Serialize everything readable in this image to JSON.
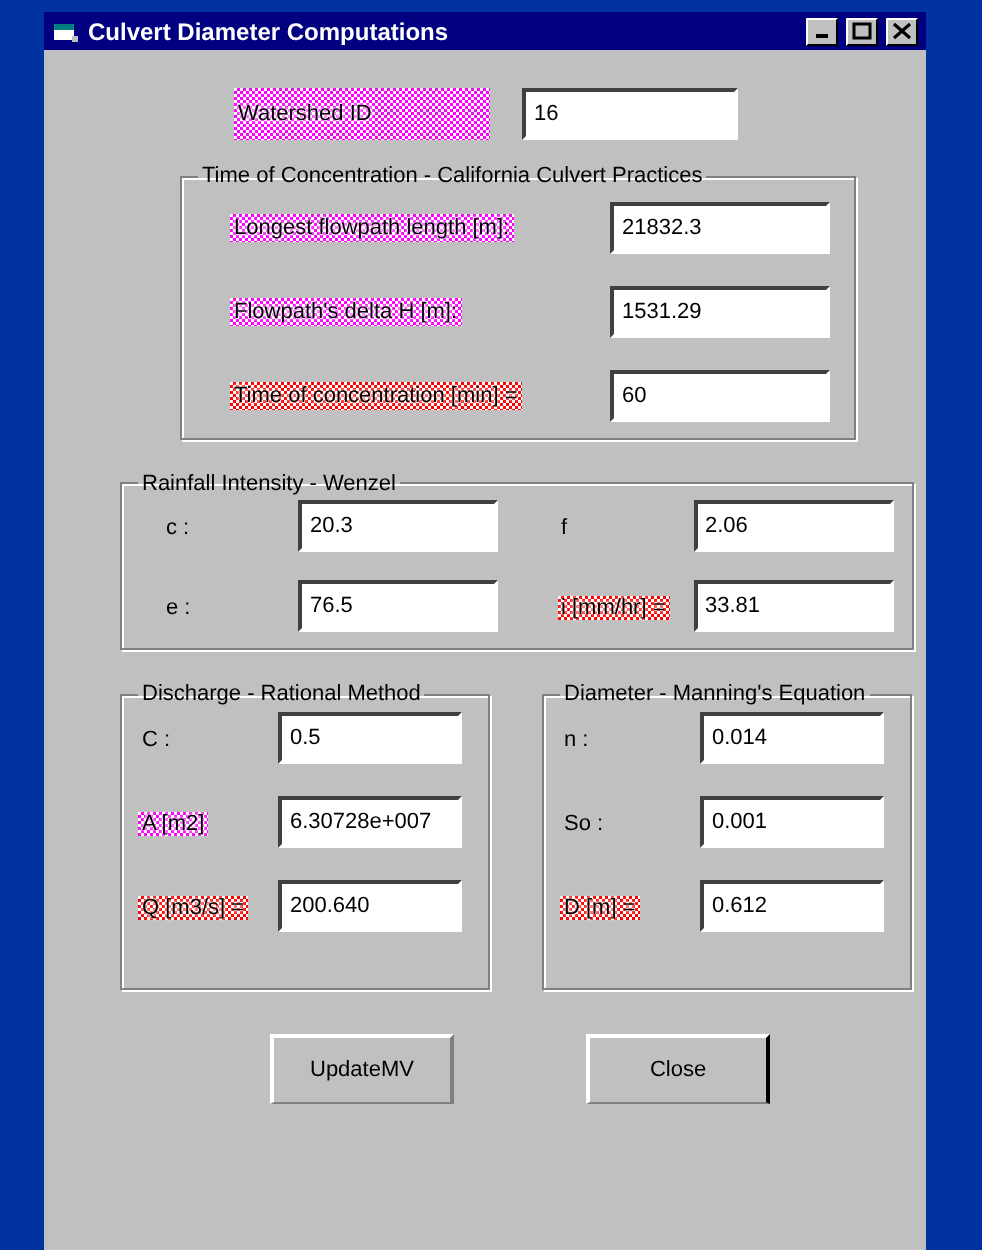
{
  "window": {
    "title": "Culvert Diameter Computations"
  },
  "watershed": {
    "label": "Watershed ID",
    "value": "16",
    "color": "#ff00ff"
  },
  "groups": [
    {
      "title": "Time of Concentration - California Culvert Practices",
      "kind": "rows",
      "fields": [
        {
          "label": "Longest flowpath length [m]:",
          "value": "21832.3",
          "color": "#ff00ff"
        },
        {
          "label": "Flowpath's delta H [m]:",
          "value": "1531.29",
          "color": "#ff00ff"
        },
        {
          "label": "Time of concentration [min] =",
          "value": "60",
          "color": "#ff0000"
        }
      ]
    },
    {
      "title": "Rainfall Intensity - Wenzel",
      "kind": "grid",
      "fields": [
        {
          "label": "c :",
          "value": "20.3"
        },
        {
          "label": "f",
          "value": "2.06"
        },
        {
          "label": "e :",
          "value": "76.5"
        },
        {
          "label": "i [mm/hr] =",
          "value": "33.81",
          "color": "#ff0000"
        }
      ]
    },
    {
      "title": "Discharge - Rational Method",
      "kind": "half",
      "fields": [
        {
          "label": "C :",
          "value": "0.5"
        },
        {
          "label": "A [m2]",
          "value": "6.30728e+007",
          "color": "#ff00ff"
        },
        {
          "label": "Q [m3/s] =",
          "value": "200.640",
          "color": "#ff0000"
        }
      ]
    },
    {
      "title": "Diameter - Manning's Equation",
      "kind": "half",
      "fields": [
        {
          "label": "n :",
          "value": "0.014"
        },
        {
          "label": "So :",
          "value": "0.001"
        },
        {
          "label": "D [m] =",
          "value": "0.612",
          "color": "#ff0000"
        }
      ]
    }
  ],
  "buttons": [
    {
      "label": "UpdateMV",
      "default": false
    },
    {
      "label": "Close",
      "default": true
    }
  ]
}
